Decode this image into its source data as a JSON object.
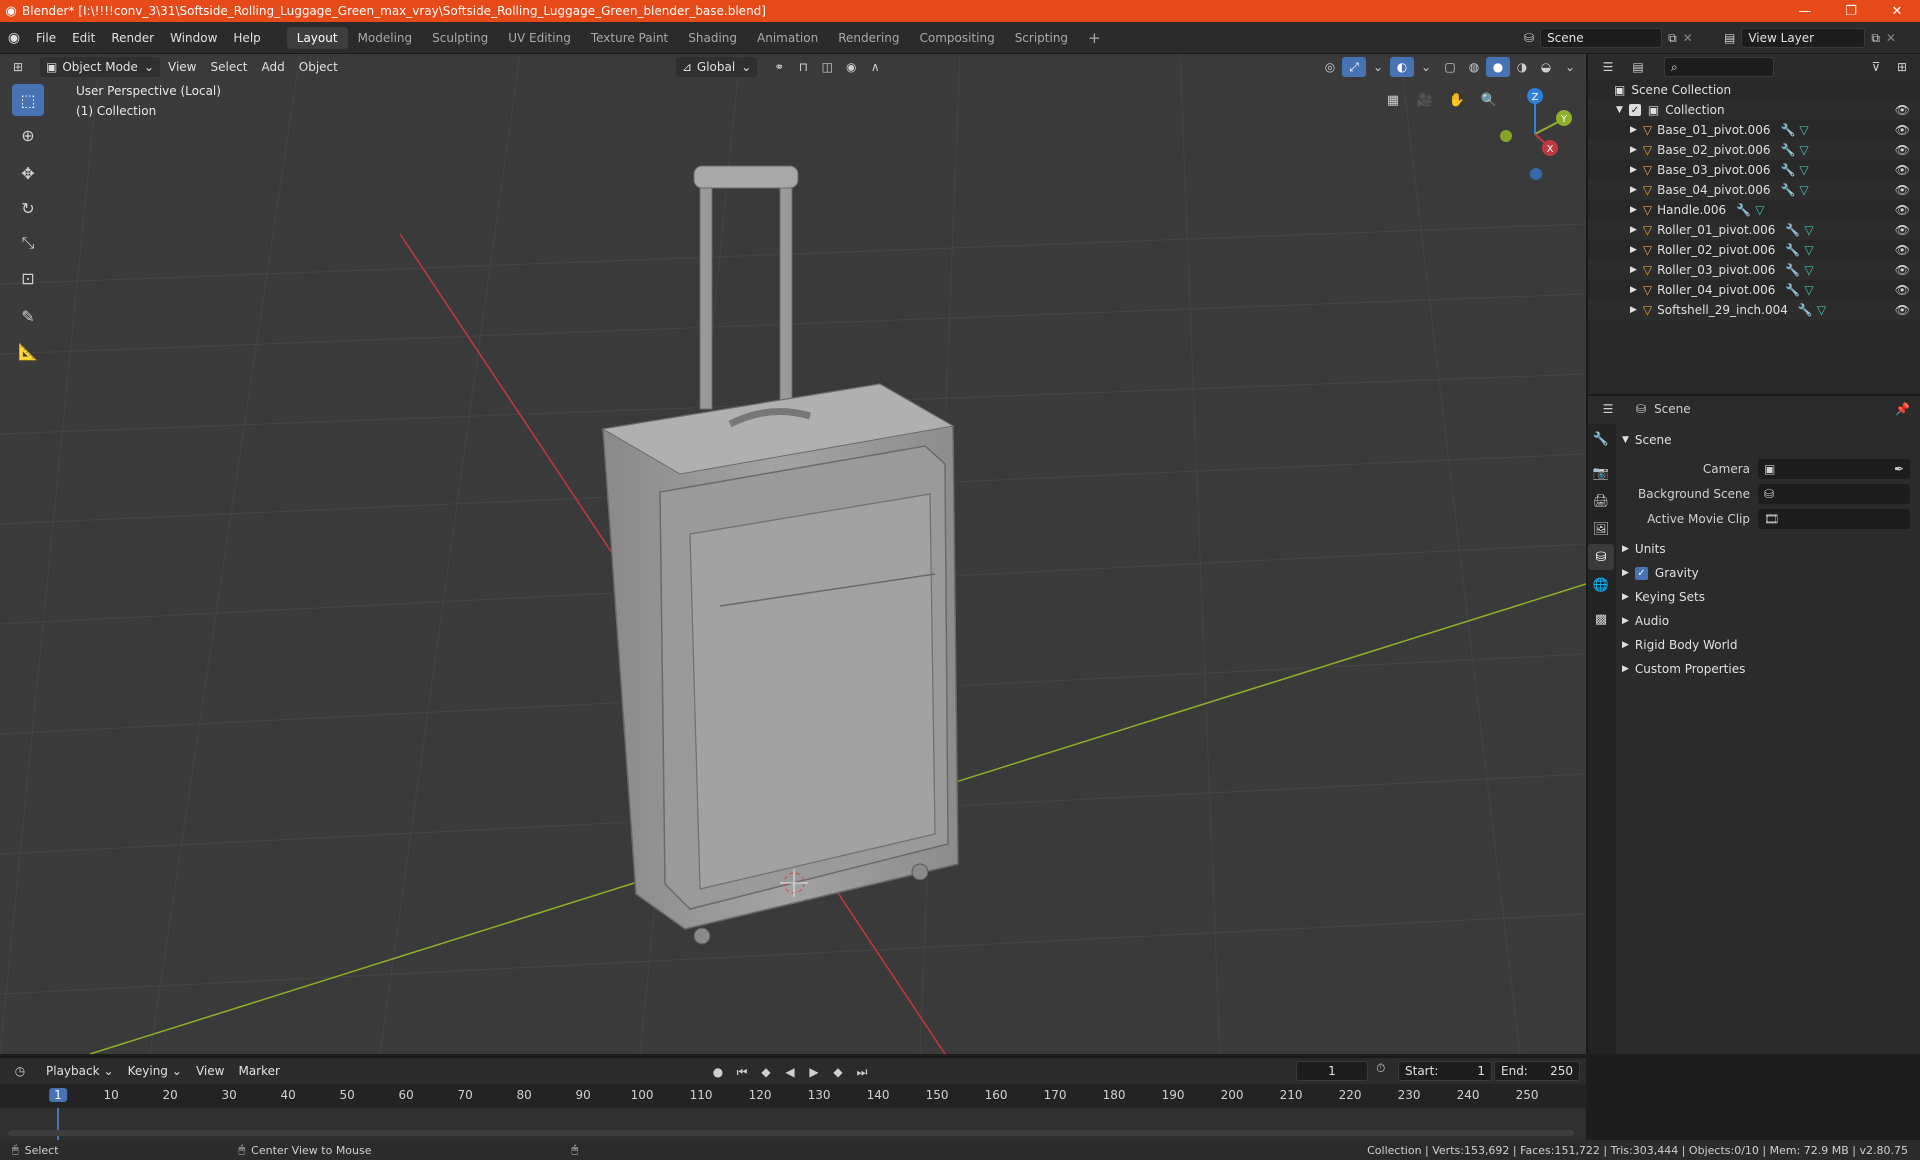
{
  "window": {
    "title": "Blender* [I:\\!!!!conv_3\\31\\Softside_Rolling_Luggage_Green_max_vray\\Softside_Rolling_Luggage_Green_blender_base.blend]",
    "minimize": "—",
    "maximize": "❐",
    "close": "✕"
  },
  "menu": [
    "File",
    "Edit",
    "Render",
    "Window",
    "Help"
  ],
  "workspaces": [
    "Layout",
    "Modeling",
    "Sculpting",
    "UV Editing",
    "Texture Paint",
    "Shading",
    "Animation",
    "Rendering",
    "Compositing",
    "Scripting"
  ],
  "topright": {
    "scene": "Scene",
    "view_layer": "View Layer"
  },
  "viewport": {
    "mode": "Object Mode",
    "menus": [
      "View",
      "Select",
      "Add",
      "Object"
    ],
    "orientation": "Global",
    "perspective": "User Perspective (Local)",
    "collection": "(1) Collection",
    "gizmo": {
      "z": "Z",
      "y": "Y",
      "x": "X"
    }
  },
  "outliner": {
    "search_placeholder": "",
    "root": "Scene Collection",
    "collection": "Collection",
    "items": [
      "Base_01_pivot.006",
      "Base_02_pivot.006",
      "Base_03_pivot.006",
      "Base_04_pivot.006",
      "Handle.006",
      "Roller_01_pivot.006",
      "Roller_02_pivot.006",
      "Roller_03_pivot.006",
      "Roller_04_pivot.006",
      "Softshell_29_inch.004"
    ]
  },
  "properties": {
    "context": "Scene",
    "section": "Scene",
    "camera_label": "Camera",
    "background_scene_label": "Background Scene",
    "active_clip_label": "Active Movie Clip",
    "panels": [
      "Units",
      "Gravity",
      "Keying Sets",
      "Audio",
      "Rigid Body World",
      "Custom Properties"
    ]
  },
  "timeline": {
    "menus": [
      "Playback",
      "Keying",
      "View",
      "Marker"
    ],
    "current_frame": "1",
    "start_label": "Start:",
    "start": "1",
    "end_label": "End:",
    "end": "250",
    "ticks": [
      "1",
      "10",
      "20",
      "30",
      "40",
      "50",
      "60",
      "70",
      "80",
      "90",
      "100",
      "110",
      "120",
      "130",
      "140",
      "150",
      "160",
      "170",
      "180",
      "190",
      "200",
      "210",
      "220",
      "230",
      "240",
      "250"
    ]
  },
  "status": {
    "select": "Select",
    "center": "Center View to Mouse",
    "stats": "Collection | Verts:153,692 | Faces:151,722 | Tris:303,444 | Objects:0/10 | Mem: 72.9 MB | v2.80.75"
  },
  "colors": {
    "accent": "#4772b3",
    "titlebar": "#e64a19",
    "x_axis": "#c0393f",
    "y_axis": "#8fb02a",
    "z_axis": "#2f7fdd"
  }
}
